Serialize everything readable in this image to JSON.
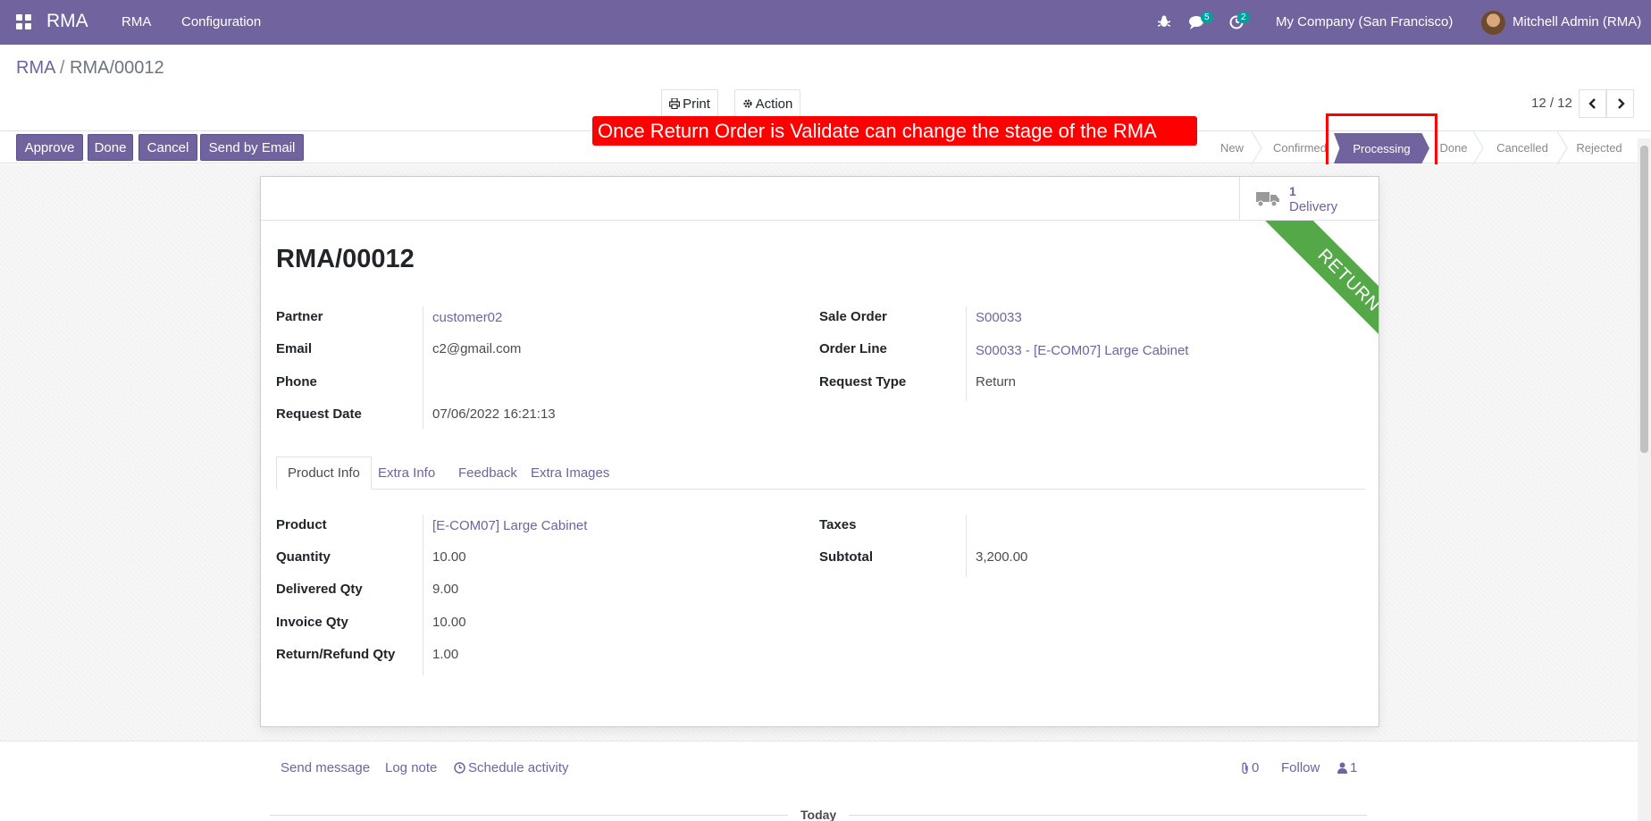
{
  "navbar": {
    "app_name": "RMA",
    "menu": [
      "RMA",
      "Configuration"
    ],
    "messages_count": "5",
    "activities_count": "2",
    "company": "My Company (San Francisco)",
    "user": "Mitchell Admin (RMA)"
  },
  "breadcrumb": {
    "parent": "RMA",
    "separator": "/",
    "current": "RMA/00012"
  },
  "toolbar": {
    "print": "Print",
    "action": "Action",
    "pager": "12 / 12"
  },
  "statusbar": {
    "buttons": [
      "Approve",
      "Done",
      "Cancel",
      "Send by Email"
    ],
    "stages": [
      "New",
      "Confirmed",
      "Processing",
      "Done",
      "Cancelled",
      "Rejected"
    ],
    "active_stage": "Processing"
  },
  "annotation": "Once Return Order is Validate can change the stage of the RMA",
  "smart_button": {
    "value": "1",
    "label": "Delivery"
  },
  "ribbon": "RETURN",
  "record": {
    "title": "RMA/00012",
    "left_fields": [
      {
        "label": "Partner",
        "value": "customer02"
      },
      {
        "label": "Email",
        "value": "c2@gmail.com"
      },
      {
        "label": "Phone",
        "value": ""
      },
      {
        "label": "Request Date",
        "value": "07/06/2022 16:21:13"
      }
    ],
    "right_fields": [
      {
        "label": "Sale Order",
        "value": "S00033"
      },
      {
        "label": "Order Line",
        "value": "S00033 - [E-COM07] Large Cabinet"
      },
      {
        "label": "Request Type",
        "value": "Return"
      }
    ]
  },
  "tabs": [
    "Product Info",
    "Extra Info",
    "Feedback",
    "Extra Images"
  ],
  "product_info": {
    "left_fields": [
      {
        "label": "Product",
        "value": "[E-COM07] Large Cabinet"
      },
      {
        "label": "Quantity",
        "value": "10.00"
      },
      {
        "label": "Delivered Qty",
        "value": "9.00"
      },
      {
        "label": "Invoice Qty",
        "value": "10.00"
      },
      {
        "label": "Return/Refund Qty",
        "value": "1.00"
      }
    ],
    "right_fields": [
      {
        "label": "Taxes",
        "value": ""
      },
      {
        "label": "Subtotal",
        "value": "3,200.00"
      }
    ]
  },
  "chatter": {
    "send_message": "Send message",
    "log_note": "Log note",
    "schedule_activity": "Schedule activity",
    "attachments": "0",
    "follow": "Follow",
    "followers": "1",
    "today": "Today"
  },
  "colors": {
    "brand": "#71639e",
    "ribbon": "#55a847",
    "annotation": "#ff0000"
  }
}
